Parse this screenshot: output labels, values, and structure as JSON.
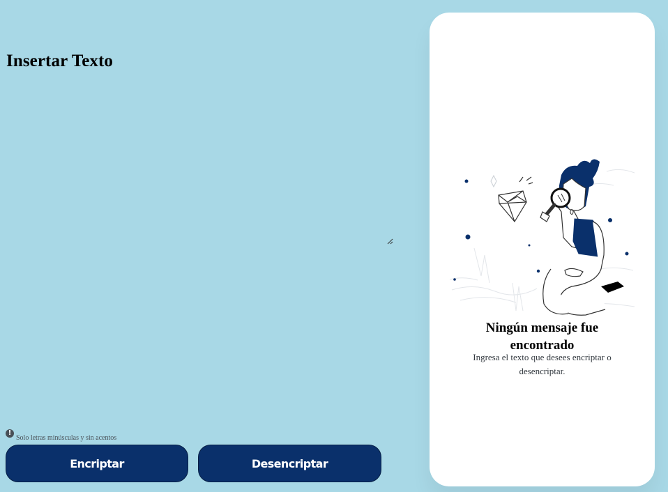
{
  "input": {
    "title": "Insertar Texto",
    "value": ""
  },
  "hint": {
    "icon": "info-circle-icon",
    "text": "Solo letras minúsculas y sin acentos"
  },
  "buttons": {
    "encrypt_label": "Encriptar",
    "decrypt_label": "Desencriptar"
  },
  "result": {
    "illustration": "person-magnifying-glass-diamond-illustration",
    "title": "Ningún mensaje fue encontrado",
    "description": "Ingresa el texto que desees encriptar o desencriptar."
  },
  "colors": {
    "background": "#a8d8e6",
    "button": "#0a306b",
    "panel": "#ffffff",
    "accent": "#0a3871"
  }
}
